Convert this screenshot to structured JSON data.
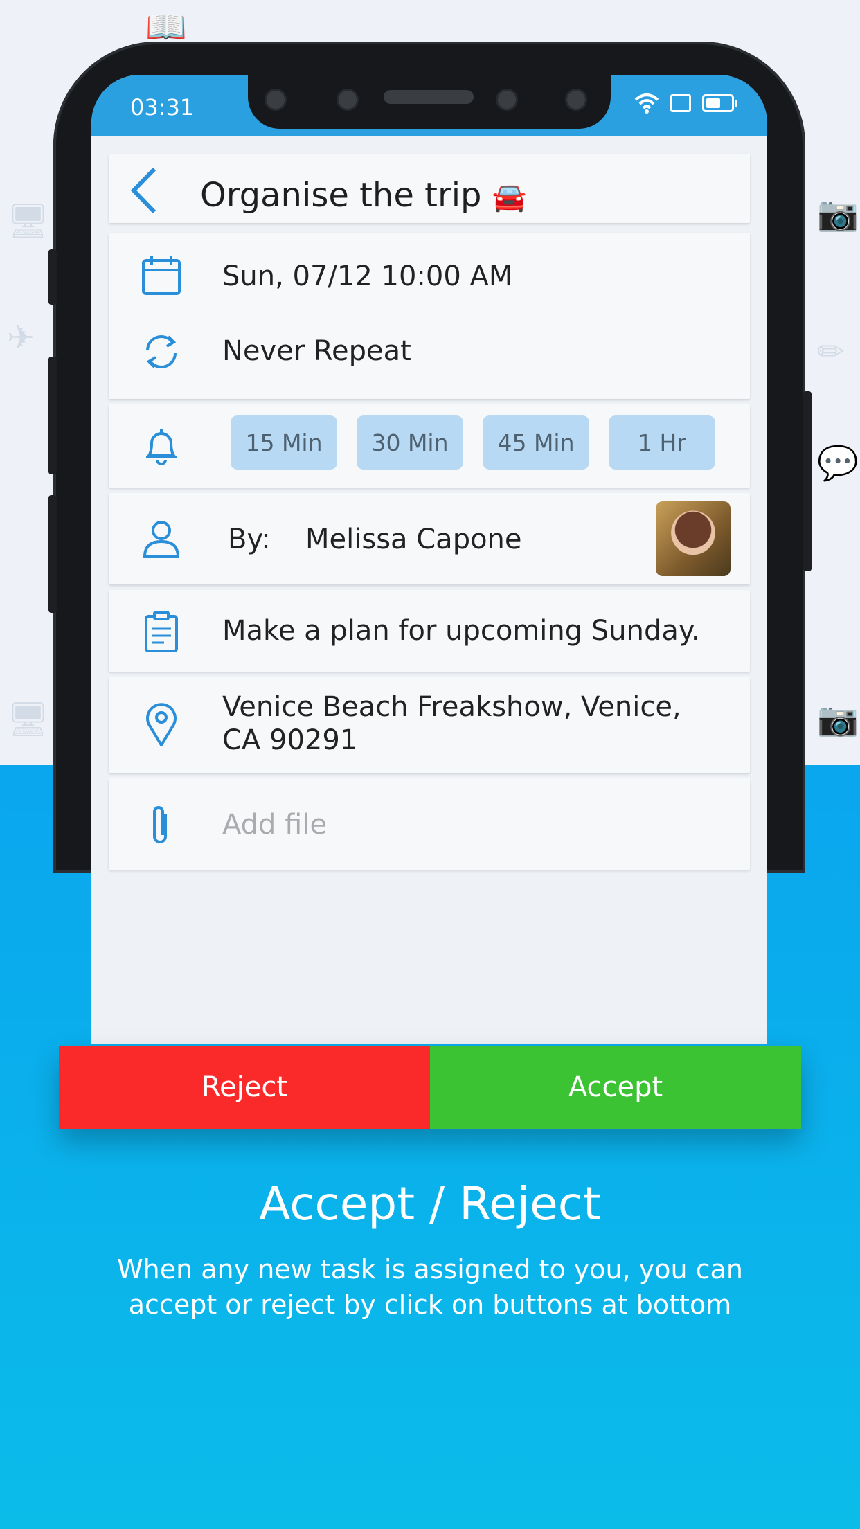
{
  "status": {
    "time": "03:31"
  },
  "header": {
    "title": "Organise the trip",
    "emoji": "🚘"
  },
  "schedule": {
    "datetime": "Sun, 07/12 10:00 AM",
    "repeat": "Never Repeat"
  },
  "reminders": {
    "options": [
      "15 Min",
      "30 Min",
      "45 Min",
      "1 Hr"
    ]
  },
  "assignee": {
    "label": "By:",
    "name": "Melissa Capone"
  },
  "note": {
    "text": "Make a plan for upcoming Sunday."
  },
  "location": {
    "line1": "Venice Beach Freakshow, Venice,",
    "line2": "CA 90291"
  },
  "attachment": {
    "placeholder": "Add file"
  },
  "actions": {
    "reject": "Reject",
    "accept": "Accept"
  },
  "caption": {
    "title": "Accept / Reject",
    "body": "When any new task is assigned to you, you can accept or reject by click on buttons at bottom"
  },
  "colors": {
    "accent": "#2a8fd8",
    "reject": "#fb2a2a",
    "accept": "#3cc333",
    "background_bottom": "#0aa6ee"
  },
  "icons": [
    "back-chevron-icon",
    "calendar-icon",
    "repeat-icon",
    "bell-icon",
    "user-icon",
    "clipboard-icon",
    "location-pin-icon",
    "paperclip-icon",
    "wifi-icon",
    "sim-icon",
    "battery-icon"
  ]
}
